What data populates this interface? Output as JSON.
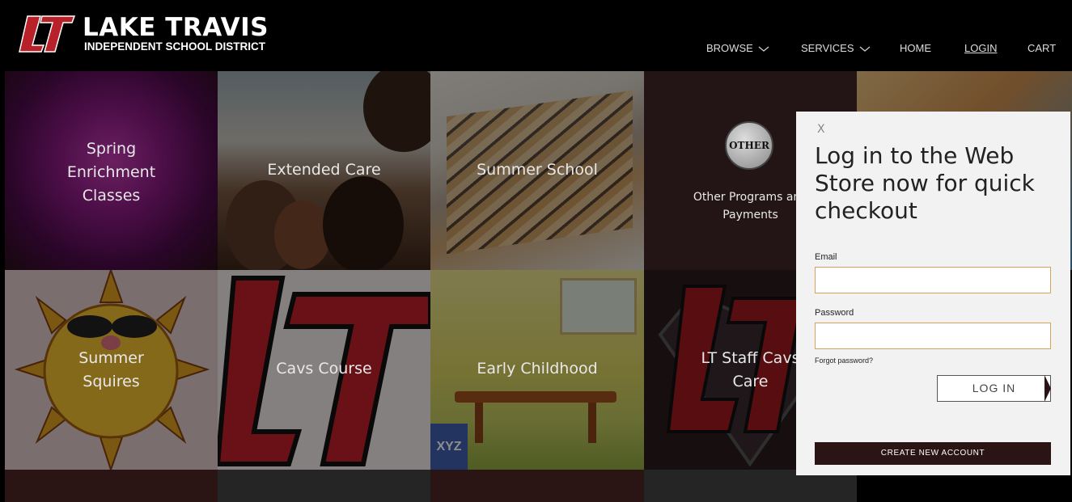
{
  "header": {
    "logo_mark": "LT",
    "logo_title": "LAKE TRAVIS",
    "logo_subtitle": "INDEPENDENT SCHOOL DISTRICT"
  },
  "nav": {
    "browse": "BROWSE",
    "services": "SERVICES",
    "home": "HOME",
    "login": "LOGIN",
    "cart": "CART"
  },
  "tiles": {
    "spring": "Spring Enrichment Classes",
    "extended": "Extended Care",
    "summer_school": "Summer School",
    "other_badge": "OTHER",
    "other": "Other Programs and Payments",
    "summer_squires": "Summer Squires",
    "cavs_course": "Cavs Course",
    "early_childhood": "Early Childhood",
    "staff_cavs_care": "LT Staff Cavs Care",
    "block_letters": "XYZ"
  },
  "modal": {
    "close": "X",
    "title": "Log in to the Web Store now for quick checkout",
    "email_label": "Email",
    "email_value": "",
    "password_label": "Password",
    "password_value": "",
    "forgot": "Forgot password?",
    "login_button": "LOG IN",
    "create_button": "CREATE NEW ACCOUNT"
  },
  "colors": {
    "brand_red": "#b8202a",
    "modal_bg": "#f2f2f2",
    "field_border": "#d4a259",
    "create_bg": "#2a1414"
  }
}
